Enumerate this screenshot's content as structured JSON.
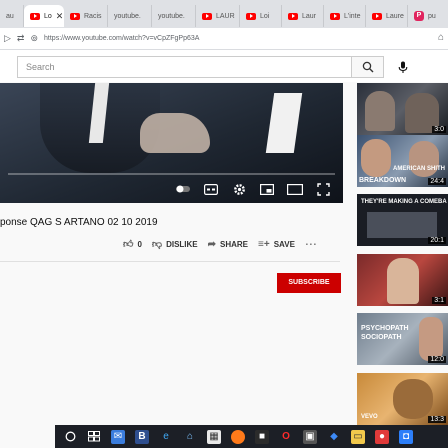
{
  "browser": {
    "tabs": [
      {
        "label": "au",
        "icon": "partial-tab"
      },
      {
        "label": "Lo",
        "icon": "youtube-icon",
        "active": true
      },
      {
        "label": "Racis",
        "icon": "youtube-icon"
      },
      {
        "label": "youtube.",
        "icon": "none"
      },
      {
        "label": "youtube.",
        "icon": "none"
      },
      {
        "label": "LAUR",
        "icon": "youtube-icon"
      },
      {
        "label": "Loi",
        "icon": "youtube-icon"
      },
      {
        "label": "Laur",
        "icon": "youtube-icon"
      },
      {
        "label": "L'inte",
        "icon": "youtube-icon"
      },
      {
        "label": "Laure",
        "icon": "youtube-icon"
      },
      {
        "label": "pu",
        "icon": "pinterest-icon"
      }
    ],
    "url": "https://www.youtube.com/watch?v=vCpZFgPp63A"
  },
  "masthead": {
    "search_placeholder": "Search"
  },
  "player": {
    "progress": 0.0
  },
  "video": {
    "title": "ponse QAG S ARTANO 02 10 2019",
    "likes": "0",
    "dislike_label": "DISLIKE",
    "share_label": "SHARE",
    "save_label": "SAVE",
    "subscribe_label": "SUBSCRIBE"
  },
  "sidebar": {
    "thumbnails": [
      {
        "duration": "3:0",
        "caption": ""
      },
      {
        "duration": "24:4",
        "caption": "BREAKDOWN",
        "caption2": "AMERICAN SHITH"
      },
      {
        "duration": "20:1",
        "caption": "THEY'RE MAKING A COMEBA"
      },
      {
        "duration": "3:1",
        "caption": ""
      },
      {
        "duration": "12:0",
        "caption": "PSYCHOPATH",
        "caption2": "SOCIOPATH"
      },
      {
        "duration": "13:3",
        "caption": "VEVO"
      }
    ]
  },
  "colors": {
    "youtube_red": "#ff0000",
    "subscribe_red": "#cc0000",
    "taskbar": "#1c1f26"
  }
}
